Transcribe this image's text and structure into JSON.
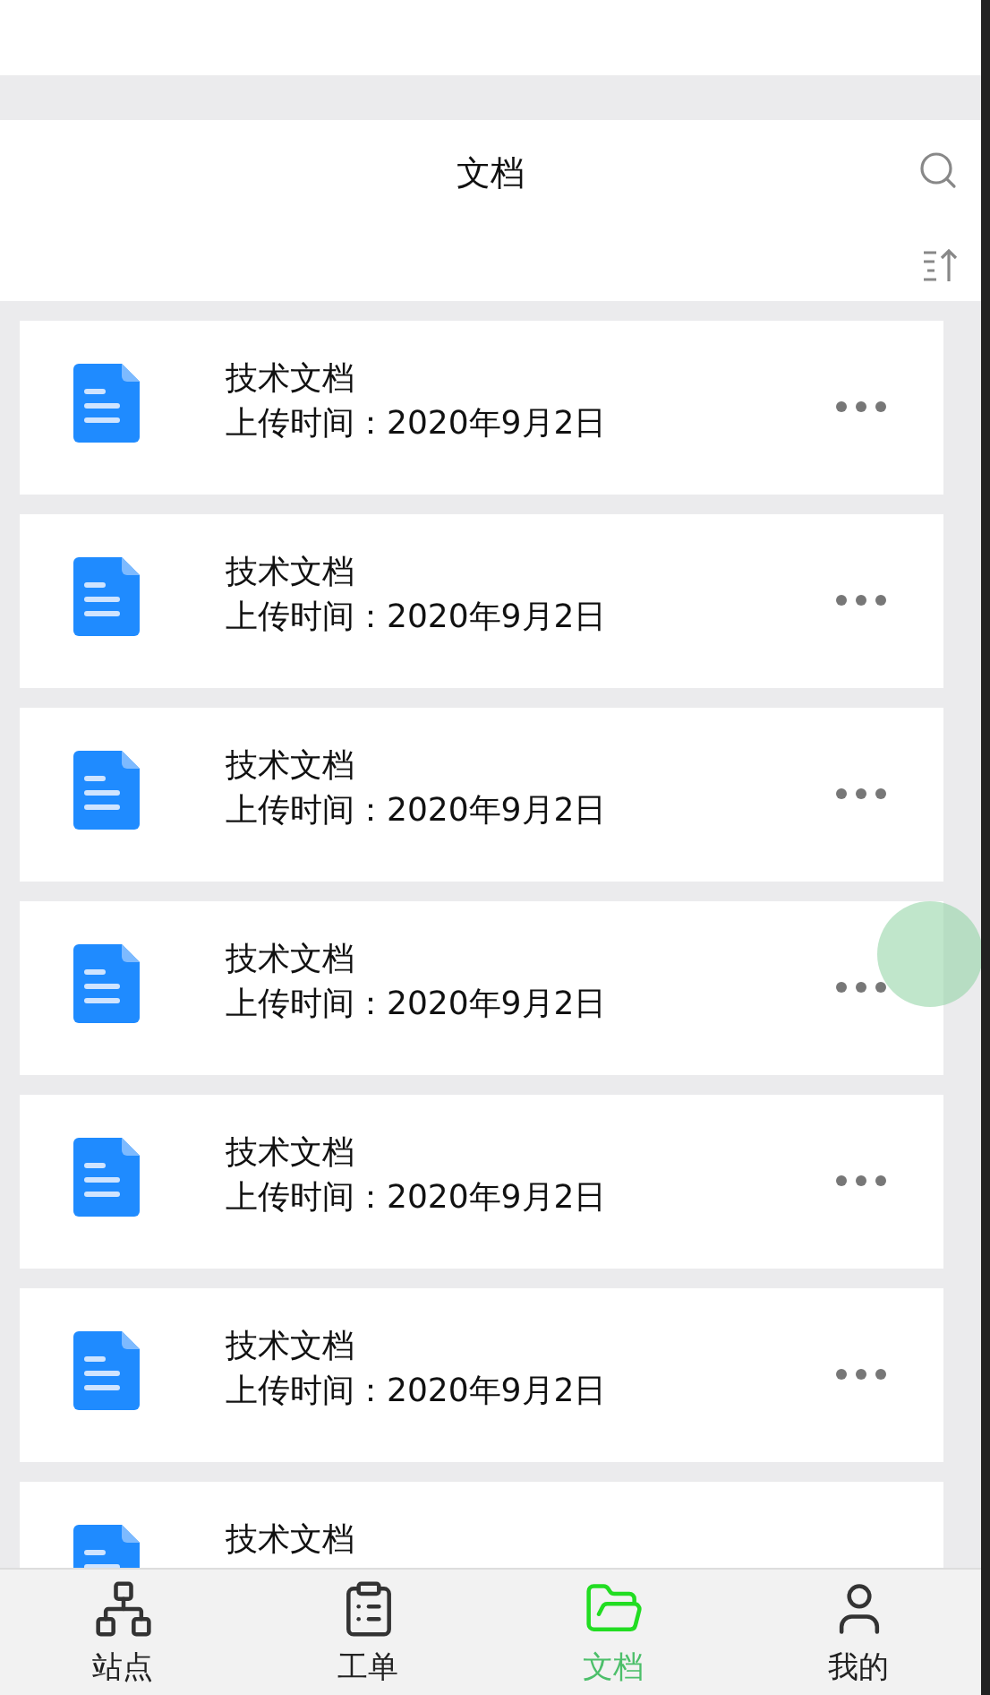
{
  "header": {
    "title": "文档"
  },
  "documents": [
    {
      "title": "技术文档",
      "date": "上传时间：2020年9月2日"
    },
    {
      "title": "技术文档",
      "date": "上传时间：2020年9月2日"
    },
    {
      "title": "技术文档",
      "date": "上传时间：2020年9月2日"
    },
    {
      "title": "技术文档",
      "date": "上传时间：2020年9月2日"
    },
    {
      "title": "技术文档",
      "date": "上传时间：2020年9月2日"
    },
    {
      "title": "技术文档",
      "date": "上传时间：2020年9月2日"
    },
    {
      "title": "技术文档"
    }
  ],
  "tabs": [
    {
      "kind": "sites",
      "label": "站点",
      "selected": false
    },
    {
      "kind": "orders",
      "label": "工单",
      "selected": false
    },
    {
      "kind": "docs",
      "label": "文档",
      "selected": true
    },
    {
      "kind": "me",
      "label": "我的",
      "selected": false
    }
  ]
}
